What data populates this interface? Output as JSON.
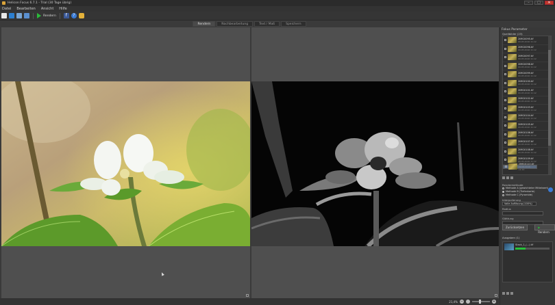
{
  "window": {
    "title": "Helicon Focus 6.7.1 - Trial (30 Tage übrig)",
    "minimize": "–",
    "maximize": "□",
    "close": "✕"
  },
  "menu": [
    "Datei",
    "Bearbeiten",
    "Ansicht",
    "Hilfe"
  ],
  "toolbar": {
    "render_label": "Rendern",
    "facebook": "f",
    "help": "?"
  },
  "tabs": [
    {
      "label": "Rendern",
      "active": true
    },
    {
      "label": "Nachbearbeitung",
      "active": false
    },
    {
      "label": "Text / Maß",
      "active": false
    },
    {
      "label": "Speichern",
      "active": false
    }
  ],
  "status": {
    "zoom": "21,4%",
    "zoom_out": "−",
    "zoom_in": "+"
  },
  "panel": {
    "title": "Fokus Parameter",
    "stack_header": "Quellbilder (23)",
    "files": [
      {
        "name": "2IMG0095.tif",
        "date": "09.05.2016 11:12"
      },
      {
        "name": "2IMG0096.tif",
        "date": "09.05.2016 11:12"
      },
      {
        "name": "2IMG0097.tif",
        "date": "09.05.2016 11:12"
      },
      {
        "name": "2IMG0098.tif",
        "date": "09.05.2016 11:12"
      },
      {
        "name": "2IMG0099.tif",
        "date": "09.05.2016 11:12"
      },
      {
        "name": "2IMG0100.tif",
        "date": "09.05.2016 11:12"
      },
      {
        "name": "2IMG0101.tif",
        "date": "09.05.2016 11:12"
      },
      {
        "name": "2IMG0102.tif",
        "date": "09.05.2016 11:12"
      },
      {
        "name": "2IMG0103.tif",
        "date": "09.05.2016 11:12"
      },
      {
        "name": "2IMG0104.tif",
        "date": "09.05.2016 11:12"
      },
      {
        "name": "2IMG0105.tif",
        "date": "09.05.2016 11:12"
      },
      {
        "name": "2IMG0106.tif",
        "date": "09.05.2016 11:12"
      },
      {
        "name": "2IMG0107.tif",
        "date": "09.05.2016 11:12"
      },
      {
        "name": "2IMG0108.tif",
        "date": "09.05.2016 11:12"
      },
      {
        "name": "2IMG0109.tif",
        "date": "09.05.2016 11:12"
      },
      {
        "name": "2IMG0110.tif",
        "date": "09.05.2016 11:12"
      }
    ],
    "method_header": "Rendermethode",
    "methods": [
      {
        "label": "Methode A (gewichteter Mittelwert)",
        "selected": false
      },
      {
        "label": "Methode B (Tiefenkarte)",
        "selected": true
      },
      {
        "label": "Methode C (Pyramide)",
        "selected": false
      }
    ],
    "interpolation_label": "Interpolierung",
    "interpolation_value": "Volle Auflösung (100%)",
    "radius_label": "Radius",
    "smoothing_label": "Glättung",
    "btn_reset": "Zurücksetzen",
    "btn_render": "Rendern",
    "output_header": "Ausgaben (1)",
    "output_file": "Stack_1_(...).tif",
    "output_progress": 0.3
  }
}
